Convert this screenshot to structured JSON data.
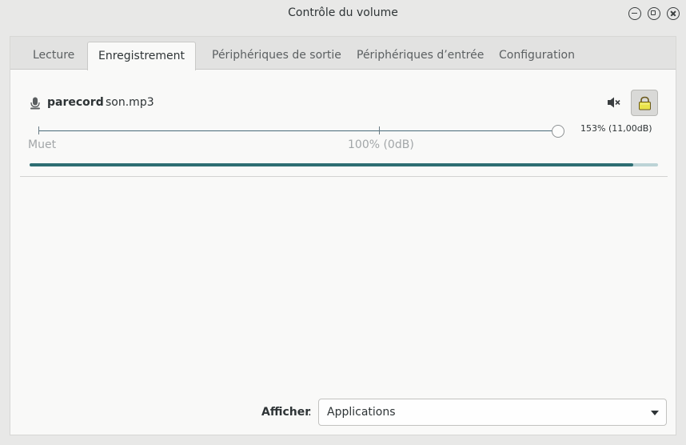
{
  "window": {
    "title": "Contrôle du volume"
  },
  "tabs": [
    {
      "label": "Lecture",
      "active": false
    },
    {
      "label": "Enregistrement",
      "active": true
    },
    {
      "label": "Périphériques de sortie",
      "active": false
    },
    {
      "label": "Périphériques d’entrée",
      "active": false
    },
    {
      "label": "Configuration",
      "active": false
    }
  ],
  "stream": {
    "app_name": "parecord",
    "separator": ":",
    "description": "son.mp3",
    "icon": "microphone-icon",
    "mute_icon": "speaker-muted-icon",
    "lock_icon": "lock-icon",
    "volume_text": "153% (11,00dB)",
    "volume_percent": 153,
    "mark_mute": "Muet",
    "mark_100": "100% (0dB)",
    "level_fraction": 0.96
  },
  "footer": {
    "show_label": "Afficher",
    "show_colon": ":",
    "show_value": "Applications"
  },
  "colors": {
    "meter_fill": "#2d6e73",
    "meter_bg": "#bcd3d6",
    "lock_fill": "#e9e34a"
  }
}
